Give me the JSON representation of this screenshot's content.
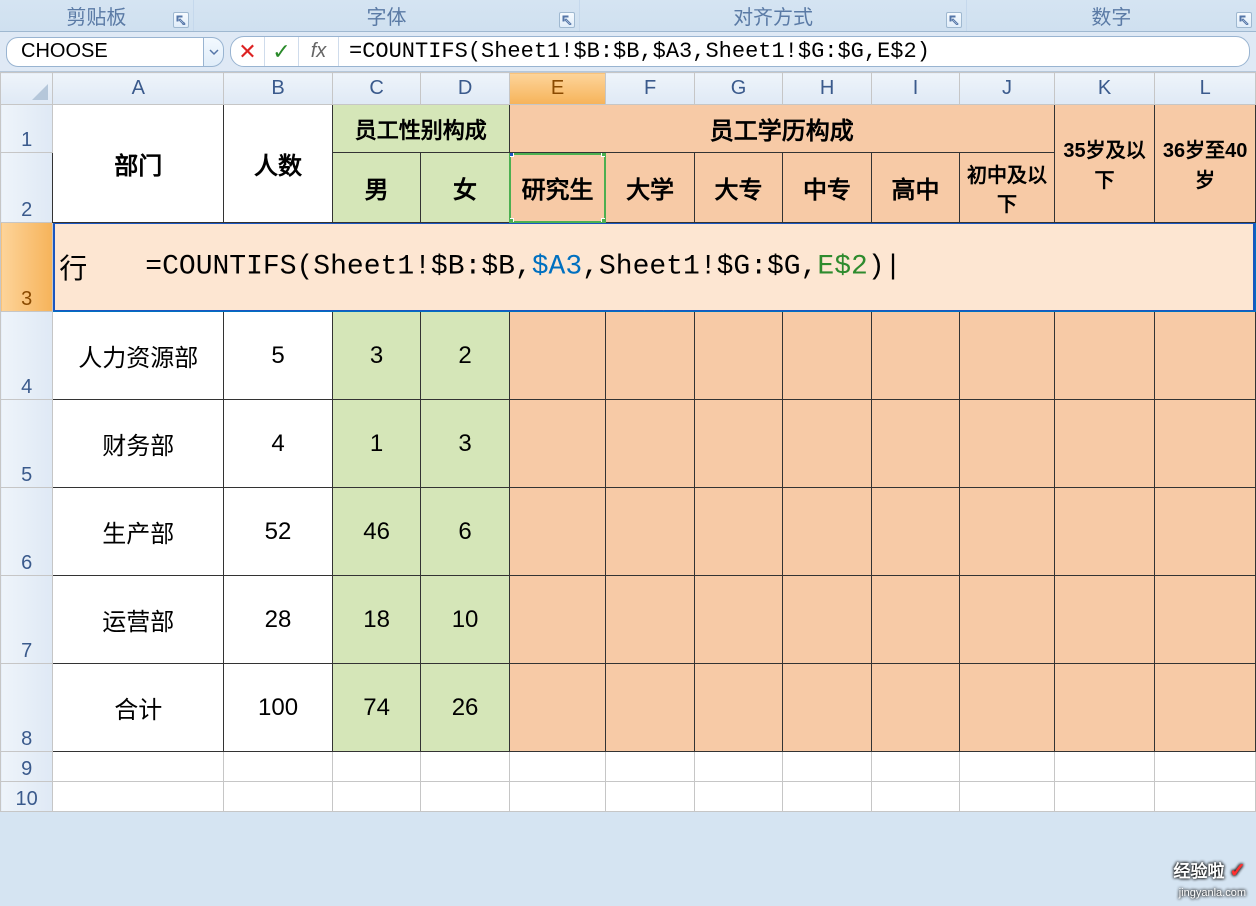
{
  "ribbon": {
    "groups": [
      "剪贴板",
      "字体",
      "对齐方式",
      "数字"
    ]
  },
  "nameBox": "CHOOSE",
  "formulaBar": "=COUNTIFS(Sheet1!$B:$B,$A3,Sheet1!$G:$G,E$2)",
  "columns": [
    "A",
    "B",
    "C",
    "D",
    "E",
    "F",
    "G",
    "H",
    "I",
    "J",
    "K",
    "L"
  ],
  "rows": [
    "1",
    "2",
    "3",
    "4",
    "5",
    "6",
    "7",
    "8",
    "9",
    "10"
  ],
  "headers": {
    "dept": "部门",
    "count": "人数",
    "genderGroup": "员工性别构成",
    "eduGroup": "员工学历构成",
    "male": "男",
    "female": "女",
    "grad": "研究生",
    "univ": "大学",
    "college": "大专",
    "secondary": "中专",
    "highschool": "高中",
    "junior": "初中及以下",
    "age35": "35岁及以下",
    "age36": "36岁至40岁"
  },
  "row3": {
    "a_prefix": "行",
    "formula_plain": "=COUNTIFS(Sheet1!$B:$B,$A3,Sheet1!$G:$G,E$2)|",
    "parts": {
      "p1": "=COUNTIFS(Sheet1!$B:$B,",
      "ref1": "$A3",
      "p2": ",Sheet1!$G:$G,",
      "ref2": "E$2",
      "p3": ")",
      "caret": "|"
    }
  },
  "dataRows": [
    {
      "dept": "人力资源部",
      "count": "5",
      "male": "3",
      "female": "2"
    },
    {
      "dept": "财务部",
      "count": "4",
      "male": "1",
      "female": "3"
    },
    {
      "dept": "生产部",
      "count": "52",
      "male": "46",
      "female": "6"
    },
    {
      "dept": "运营部",
      "count": "28",
      "male": "18",
      "female": "10"
    },
    {
      "dept": "合计",
      "count": "100",
      "male": "74",
      "female": "26"
    }
  ],
  "watermark": {
    "main": "经验啦",
    "check": "✓",
    "sub": "jingyanla.com"
  },
  "fxLabel": "fx"
}
